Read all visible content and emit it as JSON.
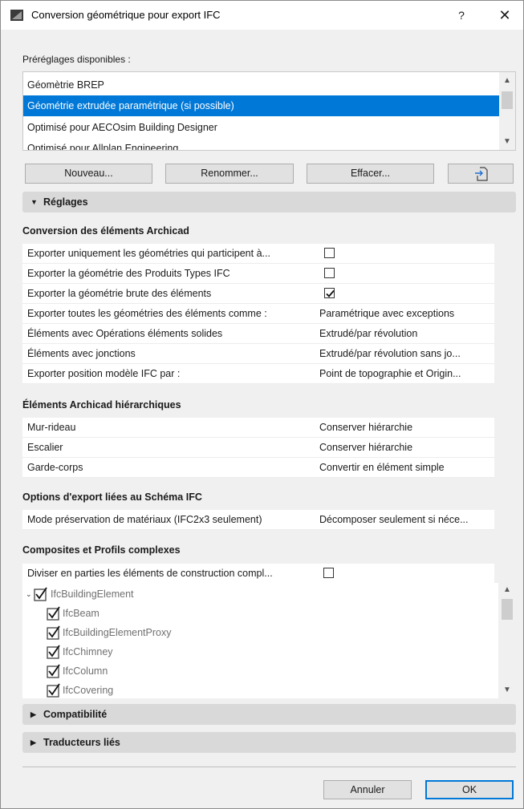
{
  "window": {
    "title": "Conversion géométrique pour export IFC",
    "help_label": "?",
    "close_label": "✕"
  },
  "presets": {
    "label": "Préréglages disponibles :",
    "items": [
      {
        "label": "Géomètrie BREP"
      },
      {
        "label": "Géométrie extrudée paramétrique (si possible)"
      },
      {
        "label": "Optimisé pour AECOsim Building Designer"
      },
      {
        "label": "Optimisé pour Allplan Engineering"
      }
    ],
    "selected_index": 1
  },
  "buttons": {
    "new": "Nouveau...",
    "rename": "Renommer...",
    "delete": "Effacer...",
    "import_icon": "import-icon"
  },
  "settings": {
    "header": "Réglages",
    "groups": {
      "conversion": {
        "title": "Conversion des éléments Archicad",
        "rows": [
          {
            "label": "Exporter uniquement les géométries qui participent à...",
            "checked": false
          },
          {
            "label": "Exporter la géométrie des Produits Types IFC",
            "checked": false
          },
          {
            "label": "Exporter la géométrie brute des éléments",
            "checked": true
          },
          {
            "label": "Exporter toutes les géométries des éléments comme :",
            "value": "Paramétrique avec exceptions"
          },
          {
            "label": "Éléments avec Opérations éléments solides",
            "value": "Extrudé/par révolution"
          },
          {
            "label": "Éléments avec jonctions",
            "value": "Extrudé/par révolution sans jo..."
          },
          {
            "label": "Exporter position modèle IFC par :",
            "value": "Point de topographie et Origin..."
          }
        ]
      },
      "hierarchy": {
        "title": "Éléments Archicad hiérarchiques",
        "rows": [
          {
            "label": "Mur-rideau",
            "value": "Conserver hiérarchie"
          },
          {
            "label": "Escalier",
            "value": "Conserver hiérarchie"
          },
          {
            "label": "Garde-corps",
            "value": "Convertir en élément simple"
          }
        ]
      },
      "schema": {
        "title": "Options d'export liées au Schéma IFC",
        "rows": [
          {
            "label": "Mode préservation de matériaux (IFC2x3 seulement)",
            "value": "Décomposer seulement si néce..."
          }
        ]
      },
      "composites": {
        "title": "Composites et Profils complexes",
        "split_label": "Diviser en parties les éléments de construction compl...",
        "split_checked": false,
        "tree": [
          {
            "label": "IfcBuildingElement",
            "checked": true,
            "level": 0,
            "expanded": true
          },
          {
            "label": "IfcBeam",
            "checked": true,
            "level": 1
          },
          {
            "label": "IfcBuildingElementProxy",
            "checked": true,
            "level": 1
          },
          {
            "label": "IfcChimney",
            "checked": true,
            "level": 1
          },
          {
            "label": "IfcColumn",
            "checked": true,
            "level": 1
          },
          {
            "label": "IfcCovering",
            "checked": true,
            "level": 1
          }
        ]
      }
    }
  },
  "collapsed_sections": {
    "compat": "Compatibilité",
    "translators": "Traducteurs liés"
  },
  "footer": {
    "cancel": "Annuler",
    "ok": "OK"
  },
  "colors": {
    "selection": "#0078d7",
    "section_bar": "#d9d9d9",
    "ok_border": "#0078d7"
  }
}
